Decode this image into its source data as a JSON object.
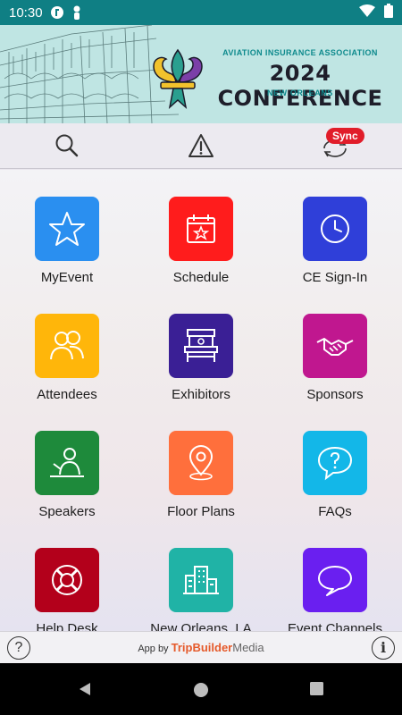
{
  "status_bar": {
    "time": "10:30"
  },
  "banner": {
    "association": "AVIATION INSURANCE ASSOCIATION",
    "conference": "2024 CONFERENCE",
    "city": "NEW ORLEANS"
  },
  "toolbar": {
    "sync_label": "Sync"
  },
  "tiles": [
    {
      "label": "MyEvent",
      "color": "#2a8ff0",
      "icon": "star-icon"
    },
    {
      "label": "Schedule",
      "color": "#ff1c1c",
      "icon": "calendar-star-icon"
    },
    {
      "label": "CE Sign-In",
      "color": "#2f3fd9",
      "icon": "clock-icon"
    },
    {
      "label": "Attendees",
      "color": "#ffb60a",
      "icon": "people-icon"
    },
    {
      "label": "Exhibitors",
      "color": "#3a1f95",
      "icon": "booth-icon"
    },
    {
      "label": "Sponsors",
      "color": "#c0178f",
      "icon": "handshake-icon"
    },
    {
      "label": "Speakers",
      "color": "#1e8a3b",
      "icon": "speaker-podium-icon"
    },
    {
      "label": "Floor Plans",
      "color": "#ff6f3c",
      "icon": "location-pin-icon"
    },
    {
      "label": "FAQs",
      "color": "#13b7e8",
      "icon": "question-bubble-icon"
    },
    {
      "label": "Help Desk",
      "color": "#b3001b",
      "icon": "lifebuoy-icon"
    },
    {
      "label": "New Orleans, LA",
      "color": "#20b3a6",
      "icon": "city-buildings-icon"
    },
    {
      "label": "Event Channels",
      "color": "#6a1ff0",
      "icon": "chat-bubble-icon"
    }
  ],
  "footer": {
    "app_by": "App by",
    "brand_a": "TripBuilder",
    "brand_b": "Media",
    "help": "?",
    "info": "i"
  }
}
